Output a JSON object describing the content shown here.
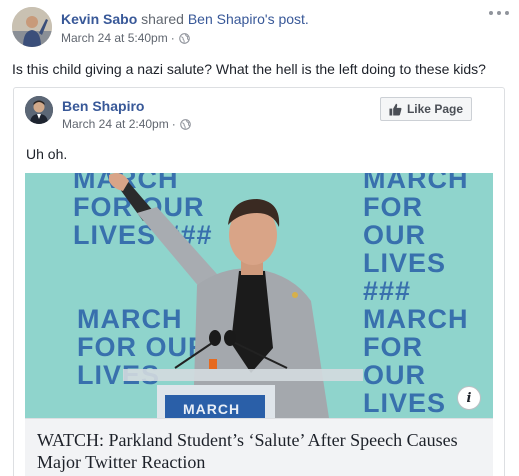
{
  "post": {
    "author": "Kevin Sabo",
    "shared_word": "shared",
    "shared_from": "Ben Shapiro's post.",
    "timestamp": "March 24 at 5:40pm",
    "status_text": "Is this child giving a nazi salute? What the hell is the left doing to these kids?",
    "privacy_icon": "globe-icon",
    "more_icon": "ellipsis-icon"
  },
  "shared_post": {
    "page_name": "Ben Shapiro",
    "timestamp": "March 24 at 2:40pm",
    "like_button_label": "Like Page",
    "text": "Uh oh.",
    "like_icon": "thumbs-up-icon"
  },
  "media": {
    "banners": [
      {
        "lines": [
          "MARCH",
          "FOR OUR",
          "LIVES ###"
        ]
      },
      {
        "lines": [
          "MARCH",
          "FOR OUR",
          "LIVES ###"
        ]
      },
      {
        "lines": [
          "MARCH",
          "FOR OUR",
          "LIVES"
        ]
      },
      {
        "lines": [
          "MARCH",
          "FOR OUR",
          "LIVES ###"
        ]
      }
    ],
    "podium_label": "MARCH",
    "info_label": "i",
    "background_color": "#8fd4cc",
    "banner_color": "#2a5fa8"
  },
  "link": {
    "title": "WATCH: Parkland Student’s ‘Salute’ After Speech Causes Major Twitter Reaction"
  }
}
